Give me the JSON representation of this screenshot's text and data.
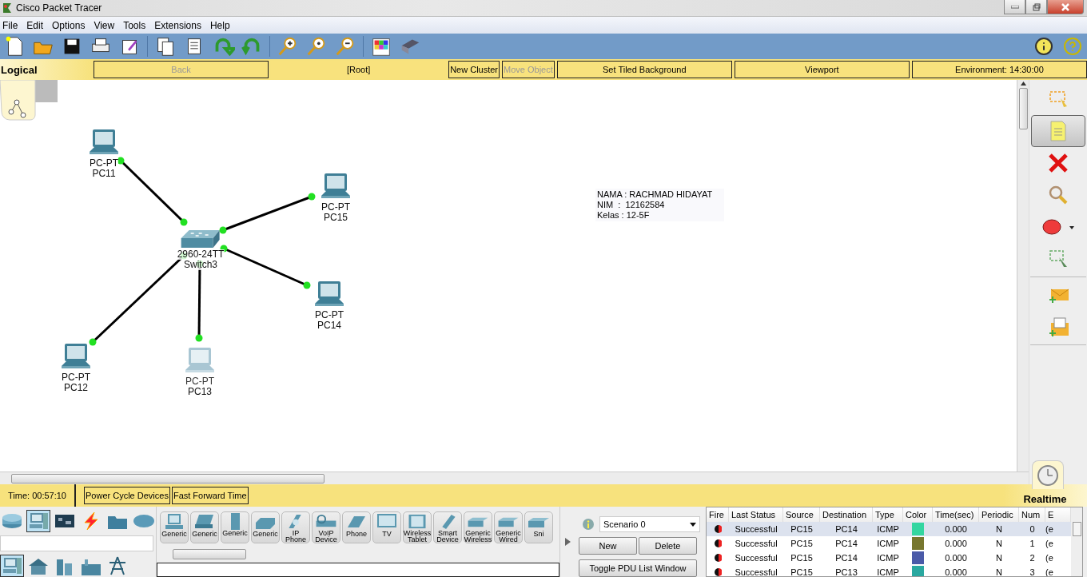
{
  "window": {
    "title": "Cisco Packet Tracer"
  },
  "menu": [
    "File",
    "Edit",
    "Options",
    "View",
    "Tools",
    "Extensions",
    "Help"
  ],
  "nav_bar": {
    "mode": "Logical",
    "buttons": [
      {
        "label": "Back",
        "disabled": true,
        "kind": "button"
      },
      {
        "label": "[Root]",
        "disabled": false,
        "kind": "label"
      },
      {
        "label": "New Cluster",
        "disabled": false,
        "kind": "compact-button"
      },
      {
        "label": "Move Object",
        "disabled": true,
        "kind": "compact-button"
      },
      {
        "label": "Set Tiled Background",
        "disabled": false,
        "kind": "button"
      },
      {
        "label": "Viewport",
        "disabled": false,
        "kind": "button"
      },
      {
        "label": "Environment: 14:30:00",
        "disabled": false,
        "kind": "button"
      }
    ]
  },
  "topology": {
    "devices": [
      {
        "kind": "pc",
        "model": "PC-PT",
        "name": "PC11",
        "dimmed": false
      },
      {
        "kind": "pc",
        "model": "PC-PT",
        "name": "PC15",
        "dimmed": false
      },
      {
        "kind": "switch",
        "model": "2960-24TT",
        "name": "Switch3",
        "dimmed": false
      },
      {
        "kind": "pc",
        "model": "PC-PT",
        "name": "PC14",
        "dimmed": false
      },
      {
        "kind": "pc",
        "model": "PC-PT",
        "name": "PC12",
        "dimmed": false
      },
      {
        "kind": "pc",
        "model": "PC-PT",
        "name": "PC13",
        "dimmed": true
      }
    ]
  },
  "note": [
    "NAMA : RACHMAD HIDAYAT",
    "NIM  :  12162584",
    "Kelas : 12-5F"
  ],
  "tool_palette": [
    {
      "kind": "select",
      "selected": false
    },
    {
      "kind": "note",
      "selected": true
    },
    {
      "kind": "delete",
      "selected": false
    },
    {
      "kind": "inspect",
      "selected": false
    },
    {
      "kind": "shape",
      "selected": false
    },
    {
      "kind": "resize",
      "selected": false
    },
    {
      "kind": "simple-pdu",
      "selected": false
    },
    {
      "kind": "complex-pdu",
      "selected": false
    }
  ],
  "status_bar": {
    "time": "Time: 00:57:10",
    "buttons": [
      "Power Cycle Devices",
      "Fast Forward Time"
    ],
    "mode": "Realtime"
  },
  "device_categories": [
    {
      "kind": "network",
      "selected": false
    },
    {
      "kind": "end-device",
      "selected": true
    },
    {
      "kind": "component",
      "selected": false
    },
    {
      "kind": "connection",
      "selected": false
    },
    {
      "kind": "misc",
      "selected": false
    },
    {
      "kind": "wan",
      "selected": false
    }
  ],
  "subcategories": [
    {
      "kind": "end-device",
      "selected": true
    },
    {
      "kind": "home",
      "selected": false
    },
    {
      "kind": "city",
      "selected": false
    },
    {
      "kind": "factory",
      "selected": false
    },
    {
      "kind": "tower",
      "selected": false
    }
  ],
  "device_list": [
    {
      "kind": "pc",
      "label": "Generic"
    },
    {
      "kind": "laptop",
      "label": "Generic"
    },
    {
      "kind": "server",
      "label": "Generic"
    },
    {
      "kind": "printer",
      "label": "Generic"
    },
    {
      "kind": "ip-phone",
      "label": "IP Phone"
    },
    {
      "kind": "voip",
      "label": "VoIP Device"
    },
    {
      "kind": "phone",
      "label": "Phone"
    },
    {
      "kind": "tv",
      "label": "TV"
    },
    {
      "kind": "tablet",
      "label": "Wireless Tablet"
    },
    {
      "kind": "smart",
      "label": "Smart Device"
    },
    {
      "kind": "box",
      "label": "Generic Wireless"
    },
    {
      "kind": "box",
      "label": "Generic Wired"
    },
    {
      "kind": "box",
      "label": "Sni"
    }
  ],
  "scenario": {
    "selected": "Scenario 0",
    "buttons": [
      "New",
      "Delete",
      "Toggle PDU List Window"
    ]
  },
  "pdu_table": {
    "columns": [
      "Fire",
      "Last Status",
      "Source",
      "Destination",
      "Type",
      "Color",
      "Time(sec)",
      "Periodic",
      "Num",
      "E"
    ],
    "rows": [
      {
        "selected": true,
        "last_status": "Successful",
        "source": "PC15",
        "destination": "PC14",
        "type": "ICMP",
        "color": "#33d6a0",
        "time": "0.000",
        "periodic": "N",
        "num": "0",
        "column_10": "(e"
      },
      {
        "selected": false,
        "last_status": "Successful",
        "source": "PC15",
        "destination": "PC14",
        "type": "ICMP",
        "color": "#77772f",
        "time": "0.000",
        "periodic": "N",
        "num": "1",
        "column_10": "(e"
      },
      {
        "selected": false,
        "last_status": "Successful",
        "source": "PC15",
        "destination": "PC14",
        "type": "ICMP",
        "color": "#4a5aa8",
        "time": "0.000",
        "periodic": "N",
        "num": "2",
        "column_10": "(e"
      },
      {
        "selected": false,
        "last_status": "Successful",
        "source": "PC15",
        "destination": "PC13",
        "type": "ICMP",
        "color": "#2aa8a0",
        "time": "0.000",
        "periodic": "N",
        "num": "3",
        "column_10": "(e"
      }
    ]
  }
}
